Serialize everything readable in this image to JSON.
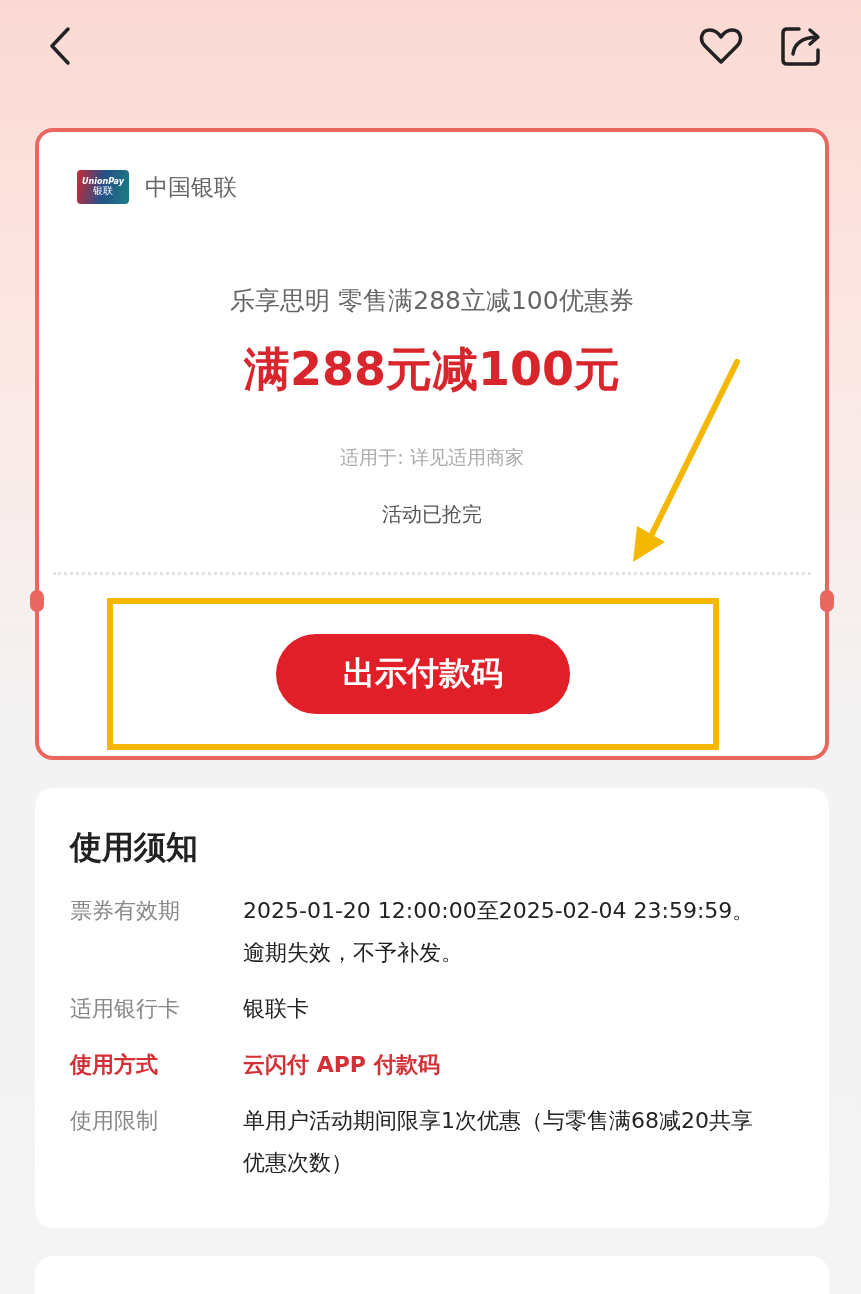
{
  "coupon": {
    "issuer": "中国银联",
    "logo_text": [
      "UnionPay",
      "银联"
    ],
    "title": "乐享思明 零售满288立减100优惠券",
    "headline": "满288元减100元",
    "applies_to": "适用于: 详见适用商家",
    "status": "活动已抢完",
    "button": "出示付款码"
  },
  "notice": {
    "heading": "使用须知",
    "rows": [
      {
        "label": "票券有效期",
        "value": "2025-01-20 12:00:00至2025-02-04 23:59:59。逾期失效，不予补发。",
        "emphasized": false
      },
      {
        "label": "适用银行卡",
        "value": "银联卡",
        "emphasized": false
      },
      {
        "label": "使用方式",
        "value": "云闪付 APP 付款码",
        "emphasized": true
      },
      {
        "label": "使用限制",
        "value": "单用户活动期间限享1次优惠（与零售满68减20共享优惠次数）",
        "emphasized": false
      }
    ]
  }
}
